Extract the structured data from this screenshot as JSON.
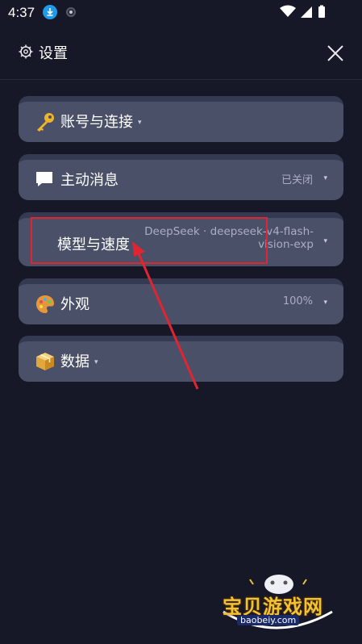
{
  "status_bar": {
    "time": "4:37"
  },
  "header": {
    "title": "设置"
  },
  "items": [
    {
      "label": "账号与连接",
      "value": "",
      "icon": "key-icon"
    },
    {
      "label": "主动消息",
      "value": "已关闭",
      "icon": "chat-bubble-icon"
    },
    {
      "label": "模型与速度",
      "value_line1": "DeepSeek · deepseek-v4-flash-",
      "value_line2": "vision-exp",
      "icon": ""
    },
    {
      "label": "外观",
      "value": "100%",
      "icon": "palette-icon"
    },
    {
      "label": "数据",
      "value": "",
      "icon": "box-icon"
    }
  ],
  "watermark": {
    "title": "宝贝游戏网",
    "url": "baobeiy.com"
  },
  "colors": {
    "background": "#161727",
    "card": "#4a5068",
    "highlight": "#e02530"
  }
}
